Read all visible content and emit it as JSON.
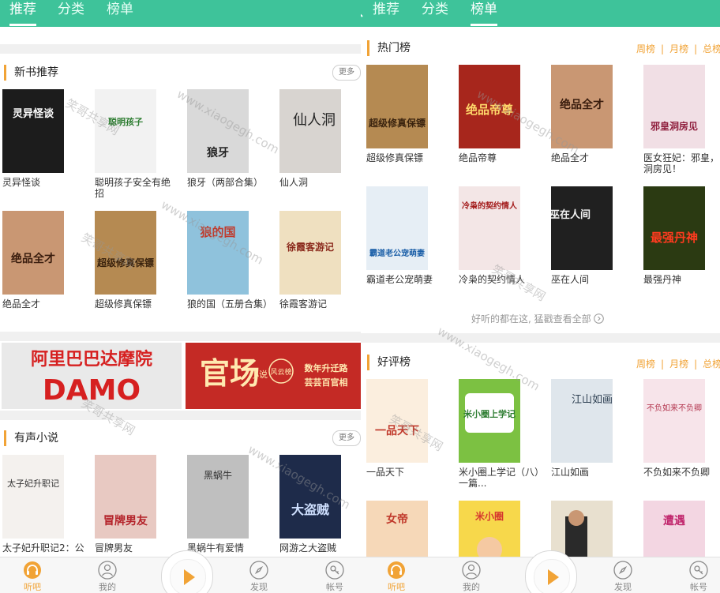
{
  "left_screen": {
    "tabs": [
      {
        "label": "推荐",
        "active": true
      },
      {
        "label": "分类",
        "active": false
      },
      {
        "label": "榜单",
        "active": false
      }
    ],
    "new_books": {
      "title": "新书推荐",
      "more_label": "更多",
      "books": [
        {
          "title": "灵异怪谈",
          "cover_text": "灵异怪谈",
          "cover_bg": "#1c1c1c",
          "cover_fg": "#ffffff"
        },
        {
          "title": "聪明孩子安全有绝招",
          "cover_text": "聪明孩子",
          "cover_bg": "#f2f2f2",
          "cover_fg": "#2e7d32"
        },
        {
          "title": "狼牙（两部合集）",
          "cover_text": "狼牙",
          "cover_bg": "#d9d9d9",
          "cover_fg": "#222222"
        },
        {
          "title": "仙人洞",
          "cover_text": "仙人洞",
          "cover_bg": "#d8d4d0",
          "cover_fg": "#222222"
        },
        {
          "title": "绝品全才",
          "cover_text": "绝品全才",
          "cover_bg": "#c99773",
          "cover_fg": "#3a1d0e"
        },
        {
          "title": "超级修真保镖",
          "cover_text": "超级修真保镖",
          "cover_bg": "#b58a52",
          "cover_fg": "#3a230e"
        },
        {
          "title": "狼的国（五册合集）",
          "cover_text": "狼的国",
          "cover_bg": "#8fc2dc",
          "cover_fg": "#c0392b"
        },
        {
          "title": "徐霞客游记",
          "cover_text": "徐霞客游记",
          "cover_bg": "#efe0c0",
          "cover_fg": "#8b2a1c"
        }
      ]
    },
    "banners": [
      {
        "line1": "阿里巴巴达摩院",
        "line2": "DAMO",
        "bg": "#e9e9e9",
        "fg": "#d62020"
      },
      {
        "line1": "官场",
        "line2": "小说",
        "badge": "风云榜",
        "tagline1": "数年升迁路",
        "tagline2": "芸芸百官相",
        "bg": "#c42a25",
        "fg": "#ffe9b0"
      }
    ],
    "audio_novels": {
      "title": "有声小说",
      "more_label": "更多",
      "books": [
        {
          "title": "太子妃升职记2：公",
          "cover_text": "太子妃升职记",
          "cover_bg": "#f4f1ee",
          "cover_fg": "#333333"
        },
        {
          "title": "冒牌男友",
          "cover_text": "冒牌男友",
          "cover_bg": "#e8c9c2",
          "cover_fg": "#b4232a"
        },
        {
          "title": "黑蜗牛有爱情",
          "cover_text": "黑蜗牛",
          "cover_bg": "#bfbfbf",
          "cover_fg": "#333333"
        },
        {
          "title": "网游之大盗贼",
          "cover_text": "大盗贼",
          "cover_bg": "#1e2b4a",
          "cover_fg": "#cfe0ff"
        }
      ]
    },
    "bottom_nav": [
      {
        "label": "听吧",
        "icon": "headphones-icon",
        "active": true
      },
      {
        "label": "我的",
        "icon": "person-icon",
        "active": false
      },
      {
        "label": "发现",
        "icon": "compass-icon",
        "active": false
      },
      {
        "label": "帐号",
        "icon": "key-icon",
        "active": false
      }
    ]
  },
  "right_screen": {
    "search_icon": "search-icon",
    "tabs": [
      {
        "label": "推荐",
        "active": false
      },
      {
        "label": "分类",
        "active": false
      },
      {
        "label": "榜单",
        "active": true
      }
    ],
    "hot": {
      "title": "热门榜",
      "filters": [
        "周榜",
        "月榜",
        "总榜"
      ],
      "books": [
        {
          "title": "超级修真保镖",
          "cover_text": "超级修真保镖",
          "cover_bg": "#b58a52",
          "cover_fg": "#3a230e"
        },
        {
          "title": "绝品帝尊",
          "cover_text": "绝品帝尊",
          "cover_bg": "#a7261c",
          "cover_fg": "#ffd86b"
        },
        {
          "title": "绝品全才",
          "cover_text": "绝品全才",
          "cover_bg": "#c99773",
          "cover_fg": "#3a1d0e"
        },
        {
          "title": "医女狂妃：邪皇，洞房见！",
          "cover_text": "邪皇洞房见",
          "cover_bg": "#f1dfe5",
          "cover_fg": "#8e1d3c"
        },
        {
          "title": "霸道老公宠萌妻",
          "cover_text": "霸道老公宠萌妻",
          "cover_bg": "#e6eef5",
          "cover_fg": "#1b5fa8"
        },
        {
          "title": "冷枭的契约情人",
          "cover_text": "冷枭的契约情人",
          "cover_bg": "#f3e6e6",
          "cover_fg": "#a31a1a"
        },
        {
          "title": "巫在人间",
          "cover_text": "巫在人间",
          "cover_bg": "#202020",
          "cover_fg": "#f2f2f2"
        },
        {
          "title": "最强丹神",
          "cover_text": "最强丹神",
          "cover_bg": "#2b3a12",
          "cover_fg": "#ff3b1f"
        }
      ],
      "see_all": "好听的都在这, 猛戳查看全部"
    },
    "praise": {
      "title": "好评榜",
      "filters": [
        "周榜",
        "月榜",
        "总榜"
      ],
      "books": [
        {
          "title": "一品天下",
          "cover_text": "一品天下",
          "cover_bg": "#fbeede",
          "cover_fg": "#c0392b"
        },
        {
          "title": "米小圈上学记（八）一篇...",
          "cover_text": "米小圈上学记",
          "cover_bg": "#7cc142",
          "cover_fg": "#ffffff"
        },
        {
          "title": "江山如画",
          "cover_text": "江山如画",
          "cover_bg": "#dfe6ec",
          "cover_fg": "#2c3e50"
        },
        {
          "title": "不负如来不负卿",
          "cover_text": "不负如来不负卿",
          "cover_bg": "#f7e4ea",
          "cover_fg": "#b3364f"
        },
        {
          "title": "",
          "cover_text": "女帝",
          "cover_bg": "#f6d8b8",
          "cover_fg": "#c0392b"
        },
        {
          "title": "",
          "cover_text": "米小圈",
          "cover_bg": "#f7d84b",
          "cover_fg": "#d6362f"
        },
        {
          "title": "",
          "cover_text": "",
          "cover_bg": "#e8e0cf",
          "cover_fg": "#5a3a1a"
        },
        {
          "title": "",
          "cover_text": "遭遇",
          "cover_bg": "#f3d6e2",
          "cover_fg": "#c0246b"
        }
      ]
    },
    "bottom_nav": [
      {
        "label": "听吧",
        "icon": "headphones-icon",
        "active": true
      },
      {
        "label": "我的",
        "icon": "person-icon",
        "active": false
      },
      {
        "label": "发现",
        "icon": "compass-icon",
        "active": false
      },
      {
        "label": "帐号",
        "icon": "key-icon",
        "active": false
      }
    ]
  },
  "watermark": {
    "text1": "笑哥共享网",
    "text2": "www.xiaogegh.com"
  },
  "colors": {
    "accent_green": "#3ec39a",
    "accent_orange": "#f1a336"
  }
}
